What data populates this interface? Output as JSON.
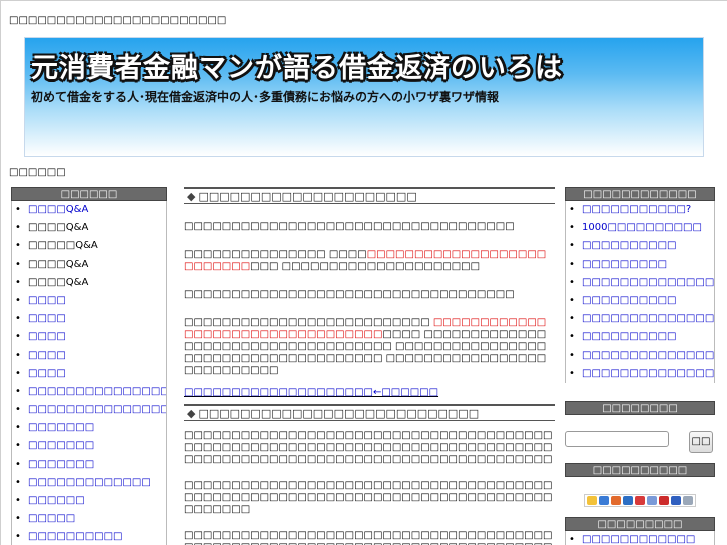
{
  "page": {
    "top_note": "□□□□□□□□□□□□□□□□□□□□□□□",
    "breadcrumb": "□□□□□□"
  },
  "banner": {
    "title": "元消費者金融マンが語る借金返済のいろは",
    "subtitle": "初めて借金をする人･現在借金返済中の人･多重債務にお悩みの方への小ワザ裏ワザ情報"
  },
  "left_sidebar": {
    "heading": "□□□□□□",
    "items": [
      "□□□□Q&A",
      "□□□□Q&A",
      "□□□□□Q&A",
      "□□□□Q&A",
      "□□□□Q&A",
      "□□□□",
      "□□□□",
      "□□□□",
      "□□□□",
      "□□□□",
      "□□□□□□□□□□□□□□□□",
      "□□□□□□□□□□□□□□□",
      "□□□□□□□",
      "□□□□□□□",
      "□□□□□□□",
      "□□□□□□□□□□□□□",
      "□□□□□□",
      "□□□□□",
      "□□□□□□□□□□"
    ]
  },
  "main": {
    "section1_heading": "□□□□□□□□□□□□□□□□□□□□□",
    "p1": "□□□□□□□□□□□□□□□□□□□□□□□□□□□□□□□□□□□",
    "p2a": "□□□□□□□□□□□□□□□ □□□□",
    "p2red": "□□□□□□□□□□□□□□□□□□□□□□□□□□",
    "p2b": "□□□ □□□□□□□□□□□□□□□□□□□□□",
    "p3": "□□□□□□□□□□□□□□□□□□□□□□□□□□□□□□□□□□□",
    "p4a": "□□□□□□□□□□□□□□□□□□□□□□□□□□ ",
    "p4red": "□□□□□□□□□□□□□□□□□□□□□□□□□□□□□□□□□",
    "p4b": "□□□□ □□□□□□□□□□□□□□□□□□□□□□□□□□□□□□□□□□□ □□□□□□□□□□□□□□□□□□□□□□□□□□□□□□□□□□□□□ □□□□□□□□□□□□□□□□□□□□□□□□□□□",
    "link1": "□□□□□□□□□□□□□□□□□□□□←□□□□□□",
    "section2_heading": "□□□□□□□□□□□□□□□□□□□□□□□□□□□",
    "p5": "□□□□□□□□□□□□□□□□□□□□□□□□□□□□□□□□□□□□□□□□□□□□□□□□□□□□□□□□□□□□□□□□□□□□□□□□□□□□□□□□□□□□□□□□□□□□□□□□□□□□□□□□□□□□□□□□□□□□□",
    "p6": "□□□□□□□□□□□□□□□□□□□□□□□□□□□□□□□□□□□□□□□□□□□□□□□□□□□□□□□□□□□□□□□□□□□□□□□□□□□□□□□□□□□□□",
    "p7": "□□□□□□□□□□□□□□□□□□□□□□□□□□□□□□□□□□□□□□□□□□□□□□□□□□□□□□□□□□□□□□□□□□□□□□□□□□□□□□□□□□□□□□□□□□□□□□□□□□□□□□□□□□□□□□□□□□□□"
  },
  "right_sidebar": {
    "heading1": "□□□□□□□□□□□□",
    "items1": [
      "□□□□□□□□□□□?",
      "1000□□□□□□□□□□",
      "□□□□□□□□□□",
      "□□□□□□□□□",
      "□□□□□□□□□□□□□□□□",
      "□□□□□□□□□□",
      "□□□□□□□□□□□□□□□□□□□□□□",
      "□□□□□□□□□□",
      "□□□□□□□□□□□□□□?",
      "□□□□□□□□□□□□□□□□□□□□□□"
    ],
    "heading2": "□□□□□□□□",
    "search_button": "□□",
    "heading3": "□□□□□□□□□□",
    "heading4": "□□□□□□□□□",
    "items4": [
      "□□□□□□□□□□□□"
    ]
  },
  "colors": {
    "sidebar_head": "#6a6a6a",
    "link": "#0000cc",
    "highlight": "#dd0000",
    "banner_top": "#26a3ee"
  }
}
